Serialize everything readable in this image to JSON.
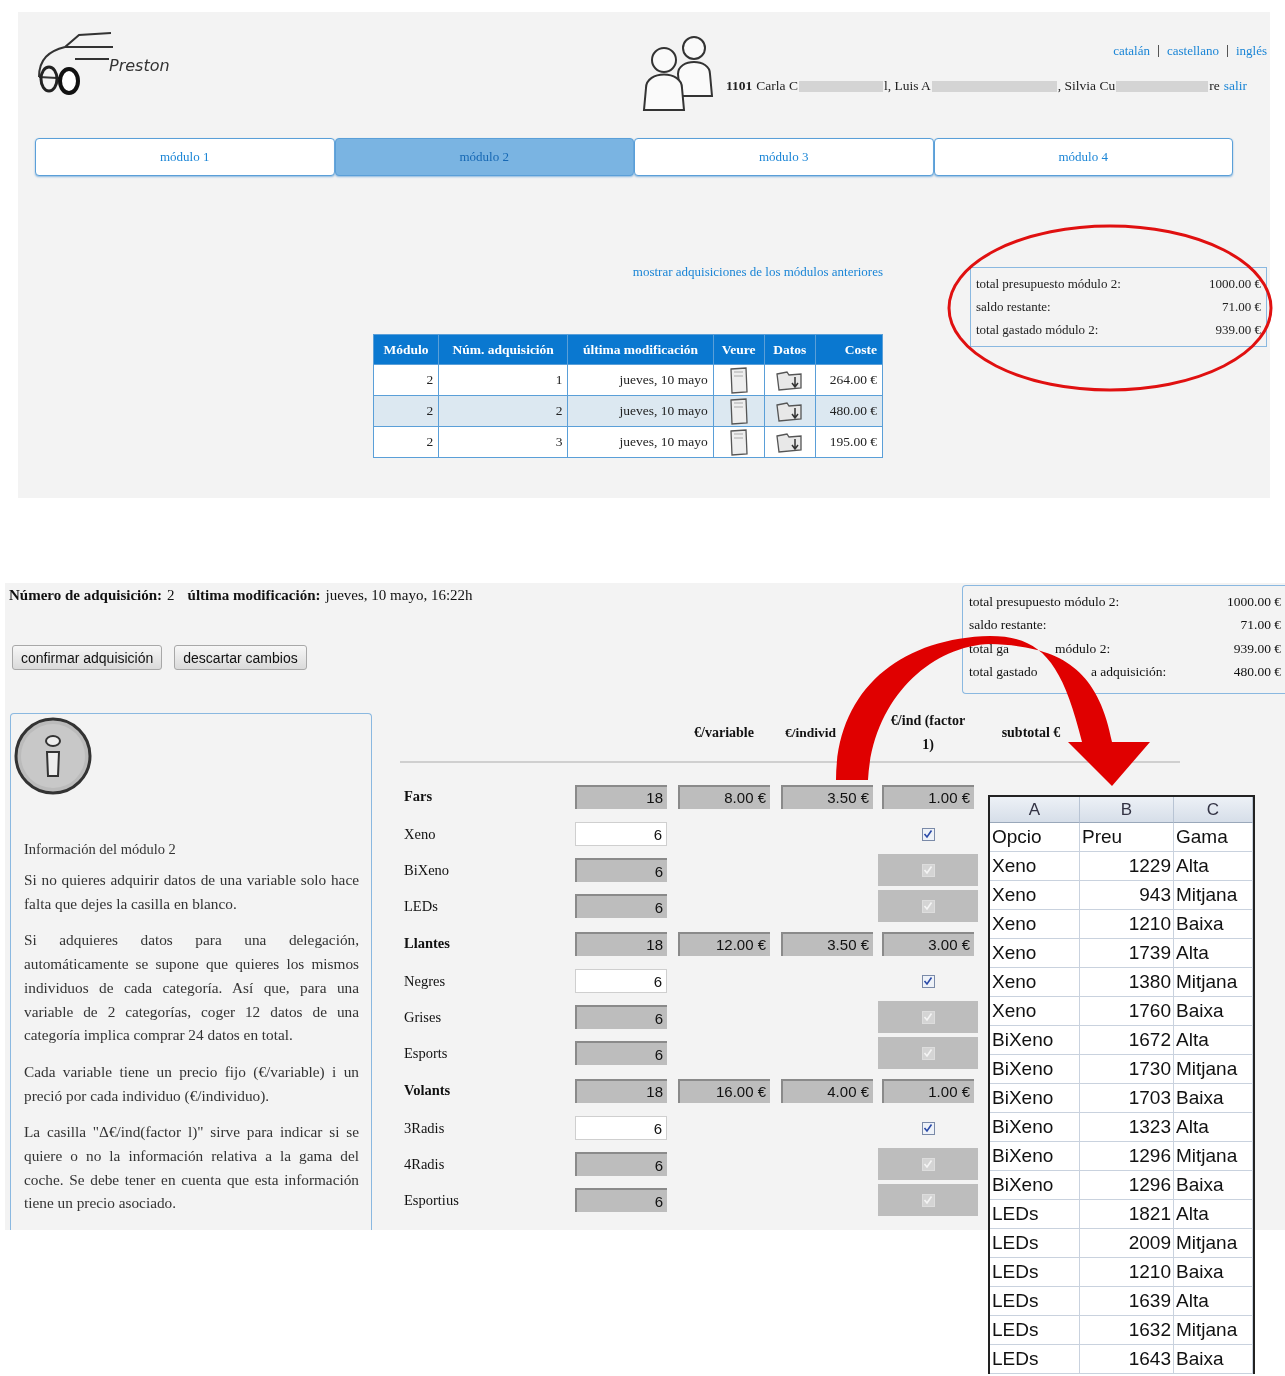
{
  "top_screen": {
    "logo": {
      "text": "Preston"
    },
    "languages": [
      {
        "label": "catalán"
      },
      {
        "label": "castellano"
      },
      {
        "label": "inglés"
      }
    ],
    "user": {
      "group": "1101",
      "name_fragments": [
        "Carla C",
        "l, Luis A",
        ", Silvia Cu",
        "re"
      ],
      "logout": "salir"
    },
    "tabs": [
      {
        "label": "módulo 1",
        "selected": false
      },
      {
        "label": "módulo 2",
        "selected": true
      },
      {
        "label": "módulo 3",
        "selected": false
      },
      {
        "label": "módulo 4",
        "selected": false
      }
    ],
    "previous_link": "mostrar adquisiciones de los módulos anteriores",
    "acquisitions": {
      "columns": [
        "Módulo",
        "Núm. adquisición",
        "última modificación",
        "Veure",
        "Datos",
        "Coste"
      ],
      "rows": [
        {
          "module": "2",
          "number": "1",
          "modified": "jueves, 10 mayo",
          "cost": "264.00 €",
          "selected": false
        },
        {
          "module": "2",
          "number": "2",
          "modified": "jueves, 10 mayo",
          "cost": "480.00 €",
          "selected": true
        },
        {
          "module": "2",
          "number": "3",
          "modified": "jueves, 10 mayo",
          "cost": "195.00 €",
          "selected": false
        }
      ]
    },
    "budget": [
      {
        "label": "total presupuesto módulo 2:",
        "value": "1000.00 €"
      },
      {
        "label": "saldo restante:",
        "value": "71.00 €"
      },
      {
        "label": "total gastado módulo 2:",
        "value": "939.00 €"
      }
    ]
  },
  "bottom_screen": {
    "header": [
      {
        "label": "Número de adquisición:",
        "value": "2"
      },
      {
        "label": "última modificación:",
        "value": "jueves, 10 mayo, 16:22h"
      }
    ],
    "buttons": [
      "confirmar adquisición",
      "descartar cambios"
    ],
    "budget": [
      {
        "label_parts": [
          "total presupuesto módulo 2:"
        ],
        "value": "1000.00 €"
      },
      {
        "label_parts": [
          "saldo restante:"
        ],
        "value": "71.00 €"
      },
      {
        "label_parts": [
          "total ga",
          "módulo 2:"
        ],
        "value": "939.00 €"
      },
      {
        "label_parts": [
          "total gastado",
          "a adquisición:"
        ],
        "value": "480.00 €"
      }
    ],
    "info": {
      "title": "Información del módulo 2",
      "paragraphs": [
        "Si no quieres adquirir datos de una variable solo hace falta que dejes la casilla en blanco.",
        "Si adquieres datos para una delegación, automáticamente se supone que quieres los mismos individuos de cada categoría. Así que, para una variable de 2 categorías, coger 12 datos de una categoría implica comprar 24 datos en total.",
        "Cada variable tiene un precio fijo (€/variable) i un preció por cada individuo (€/individuo).",
        "La casilla \"Δ€/ind(factor l)\" sirve para indicar si se quiere o no la información relativa a la gama del coche. Se debe tener en cuenta que esta información tiene un precio asociado."
      ]
    },
    "grid": {
      "columns": [
        "€/variable",
        "€/individ",
        "€/ind (factor 1)",
        "subtotal €"
      ],
      "rows": [
        {
          "kind": "variable",
          "label": "Fars",
          "quantity": "18",
          "per_variable": "8.00 €",
          "per_individual": "3.50 €",
          "delta": "1.00 €"
        },
        {
          "kind": "category",
          "label": "Xeno",
          "quantity": "6",
          "editable": true,
          "checked": true,
          "disabled": false
        },
        {
          "kind": "category",
          "label": "BiXeno",
          "quantity": "6",
          "editable": false,
          "checked": true,
          "disabled": true
        },
        {
          "kind": "category",
          "label": "LEDs",
          "quantity": "6",
          "editable": false,
          "checked": true,
          "disabled": true
        },
        {
          "kind": "variable",
          "label": "Llantes",
          "quantity": "18",
          "per_variable": "12.00 €",
          "per_individual": "3.50 €",
          "delta": "3.00 €"
        },
        {
          "kind": "category",
          "label": "Negres",
          "quantity": "6",
          "editable": true,
          "checked": true,
          "disabled": false
        },
        {
          "kind": "category",
          "label": "Grises",
          "quantity": "6",
          "editable": false,
          "checked": true,
          "disabled": true
        },
        {
          "kind": "category",
          "label": "Esports",
          "quantity": "6",
          "editable": false,
          "checked": true,
          "disabled": true
        },
        {
          "kind": "variable",
          "label": "Volants",
          "quantity": "18",
          "per_variable": "16.00 €",
          "per_individual": "4.00 €",
          "delta": "1.00 €"
        },
        {
          "kind": "category",
          "label": "3Radis",
          "quantity": "6",
          "editable": true,
          "checked": true,
          "disabled": false
        },
        {
          "kind": "category",
          "label": "4Radis",
          "quantity": "6",
          "editable": false,
          "checked": true,
          "disabled": true
        },
        {
          "kind": "category",
          "label": "Esportius",
          "quantity": "6",
          "editable": false,
          "checked": true,
          "disabled": true
        }
      ]
    }
  },
  "spreadsheet": {
    "columns": [
      "A",
      "B",
      "C"
    ],
    "header_row": [
      "Opcio",
      "Preu",
      "Gama"
    ],
    "rows": [
      [
        "Xeno",
        "1229",
        "Alta"
      ],
      [
        "Xeno",
        "943",
        "Mitjana"
      ],
      [
        "Xeno",
        "1210",
        "Baixa"
      ],
      [
        "Xeno",
        "1739",
        "Alta"
      ],
      [
        "Xeno",
        "1380",
        "Mitjana"
      ],
      [
        "Xeno",
        "1760",
        "Baixa"
      ],
      [
        "BiXeno",
        "1672",
        "Alta"
      ],
      [
        "BiXeno",
        "1730",
        "Mitjana"
      ],
      [
        "BiXeno",
        "1703",
        "Baixa"
      ],
      [
        "BiXeno",
        "1323",
        "Alta"
      ],
      [
        "BiXeno",
        "1296",
        "Mitjana"
      ],
      [
        "BiXeno",
        "1296",
        "Baixa"
      ],
      [
        "LEDs",
        "1821",
        "Alta"
      ],
      [
        "LEDs",
        "2009",
        "Mitjana"
      ],
      [
        "LEDs",
        "1210",
        "Baixa"
      ],
      [
        "LEDs",
        "1639",
        "Alta"
      ],
      [
        "LEDs",
        "1632",
        "Mitjana"
      ],
      [
        "LEDs",
        "1643",
        "Baixa"
      ]
    ]
  }
}
